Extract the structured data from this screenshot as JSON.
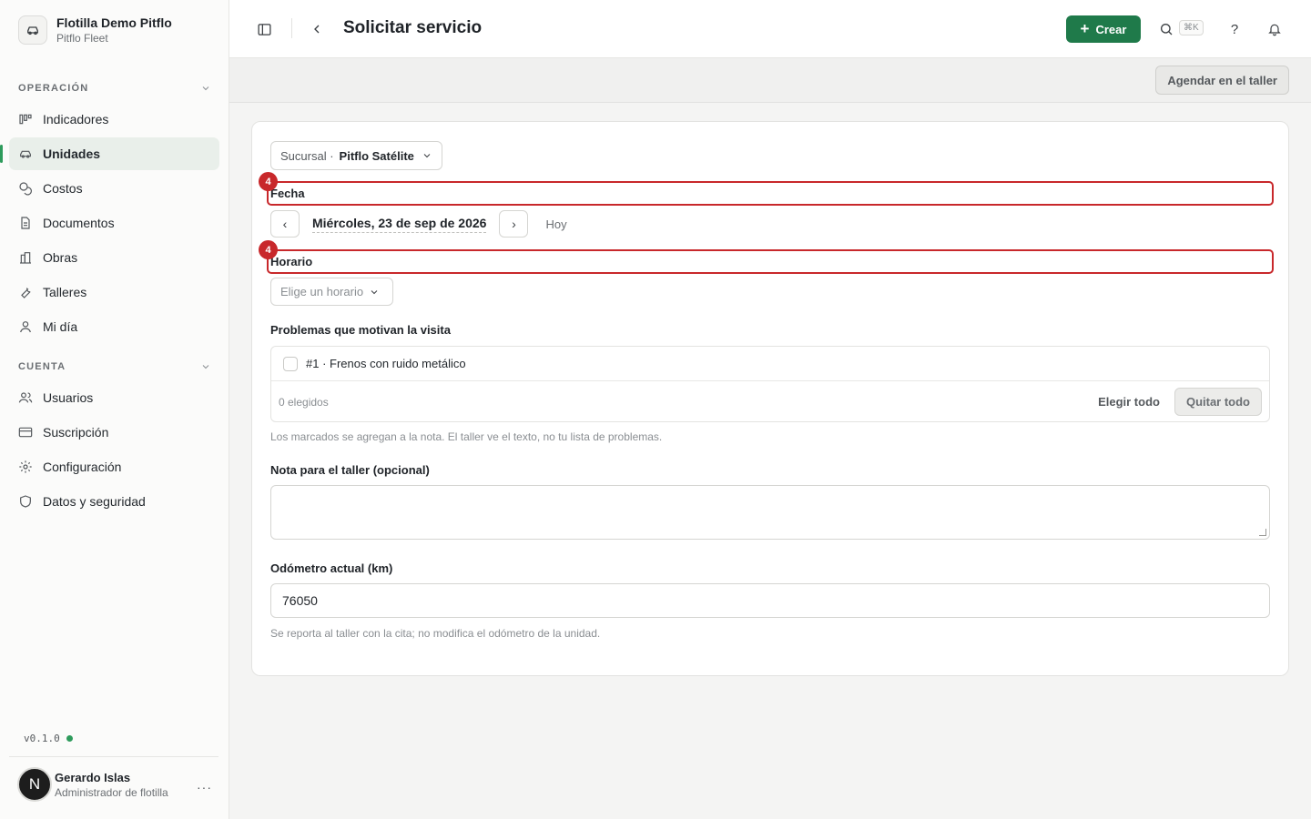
{
  "sidebar": {
    "org_name": "Flotilla Demo Pitflo",
    "org_sub": "Pitflo Fleet",
    "section_operacion": "OPERACIÓN",
    "section_cuenta": "CUENTA",
    "items_operacion": [
      {
        "label": "Indicadores"
      },
      {
        "label": "Unidades",
        "active": true
      },
      {
        "label": "Costos"
      },
      {
        "label": "Documentos"
      },
      {
        "label": "Obras"
      },
      {
        "label": "Talleres"
      },
      {
        "label": "Mi día"
      }
    ],
    "items_cuenta": [
      {
        "label": "Usuarios"
      },
      {
        "label": "Suscripción"
      },
      {
        "label": "Configuración"
      },
      {
        "label": "Datos y seguridad"
      }
    ],
    "version": "v0.1.0",
    "status_color": "#2e9b5c",
    "user": {
      "initial": "N",
      "name": "Gerardo Islas",
      "role": "Administrador de flotilla",
      "more": "···"
    }
  },
  "header": {
    "title": "Solicitar servicio",
    "create_label": "Crear",
    "shortcut": "⌘K",
    "help_glyph": "?",
    "accent": "#1f7a4a"
  },
  "subbar": {
    "schedule_button": "Agendar en el taller"
  },
  "form": {
    "branch_label": "Sucursal ·",
    "branch_value": "Pitflo Satélite",
    "date_label": "Fecha",
    "date_prev": "‹",
    "date_value": "Miércoles, 23 de sep de 2026",
    "date_next": "›",
    "today_label": "Hoy",
    "time_label": "Horario",
    "time_placeholder": "Elige un horario",
    "highlight_badge": "4",
    "highlight_color": "#c8282b",
    "problems_label": "Problemas que motivan la visita",
    "problems": [
      {
        "label": "#1 · Frenos con ruido metálico",
        "checked": false
      }
    ],
    "selected_count": "0 elegidos",
    "select_all": "Elegir todo",
    "clear_all": "Quitar todo",
    "problems_help": "Los marcados se agregan a la nota. El taller ve el texto, no tu lista de problemas.",
    "note_label": "Nota para el taller (opcional)",
    "note_value": "",
    "odometer_label": "Odómetro actual (km)",
    "odometer_value": "76050",
    "odometer_help": "Se reporta al taller con la cita; no modifica el odómetro de la unidad."
  }
}
